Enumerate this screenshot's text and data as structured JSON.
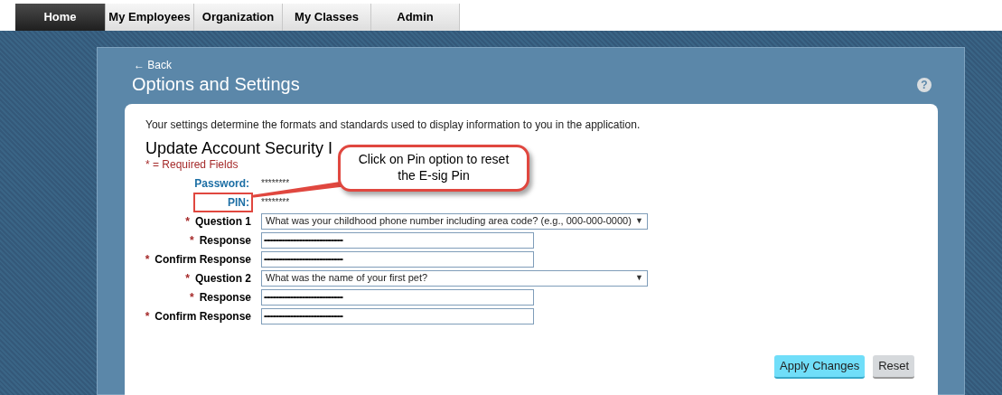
{
  "nav_tabs": [
    {
      "label": "Home",
      "selected": true
    },
    {
      "label": "My Employees",
      "selected": false
    },
    {
      "label": "Organization",
      "selected": false
    },
    {
      "label": "My Classes",
      "selected": false
    },
    {
      "label": "Admin",
      "selected": false
    }
  ],
  "back_link": "← Back",
  "page_title": "Options and Settings",
  "help_icon": "?",
  "intro": "Your settings determine the formats and standards used to display information to you in the application.",
  "section_title": "Update Account Security I",
  "required_note": "* = Required Fields",
  "fields": [
    {
      "kind": "link",
      "label": "Password:",
      "value": "********",
      "highlighted": false
    },
    {
      "kind": "link",
      "label": "PIN:",
      "value": "********",
      "highlighted": true
    },
    {
      "kind": "select",
      "required": true,
      "required_mark": "*",
      "label": "Question 1",
      "value": "What was your childhood phone number including area code? (e.g., 000-000-0000)",
      "arrow": "▼"
    },
    {
      "kind": "input",
      "required": true,
      "required_mark": "*",
      "label": "Response",
      "value": "••••••••••••••••••••••••••••••••••••••••••••••••••••••••••••"
    },
    {
      "kind": "input",
      "required": true,
      "required_mark": "*",
      "label": "Confirm Response",
      "value": "••••••••••••••••••••••••••••••••••••••••••••••••••••••••••••"
    },
    {
      "kind": "select",
      "required": true,
      "required_mark": "*",
      "label": "Question 2",
      "value": "What was the name of your first pet?",
      "arrow": "▼"
    },
    {
      "kind": "input",
      "required": true,
      "required_mark": "*",
      "label": "Response",
      "value": "••••••••••••••••••••••••••••••••••••••••••••••••••••••••••••"
    },
    {
      "kind": "input",
      "required": true,
      "required_mark": "*",
      "label": "Confirm Response",
      "value": "••••••••••••••••••••••••••••••••••••••••••••••••••••••••••••"
    }
  ],
  "callout": "Click on Pin option to reset the E-sig Pin",
  "buttons": [
    {
      "kind": "primary",
      "label": "Apply Changes"
    },
    {
      "kind": "secondary",
      "label": "Reset"
    }
  ]
}
